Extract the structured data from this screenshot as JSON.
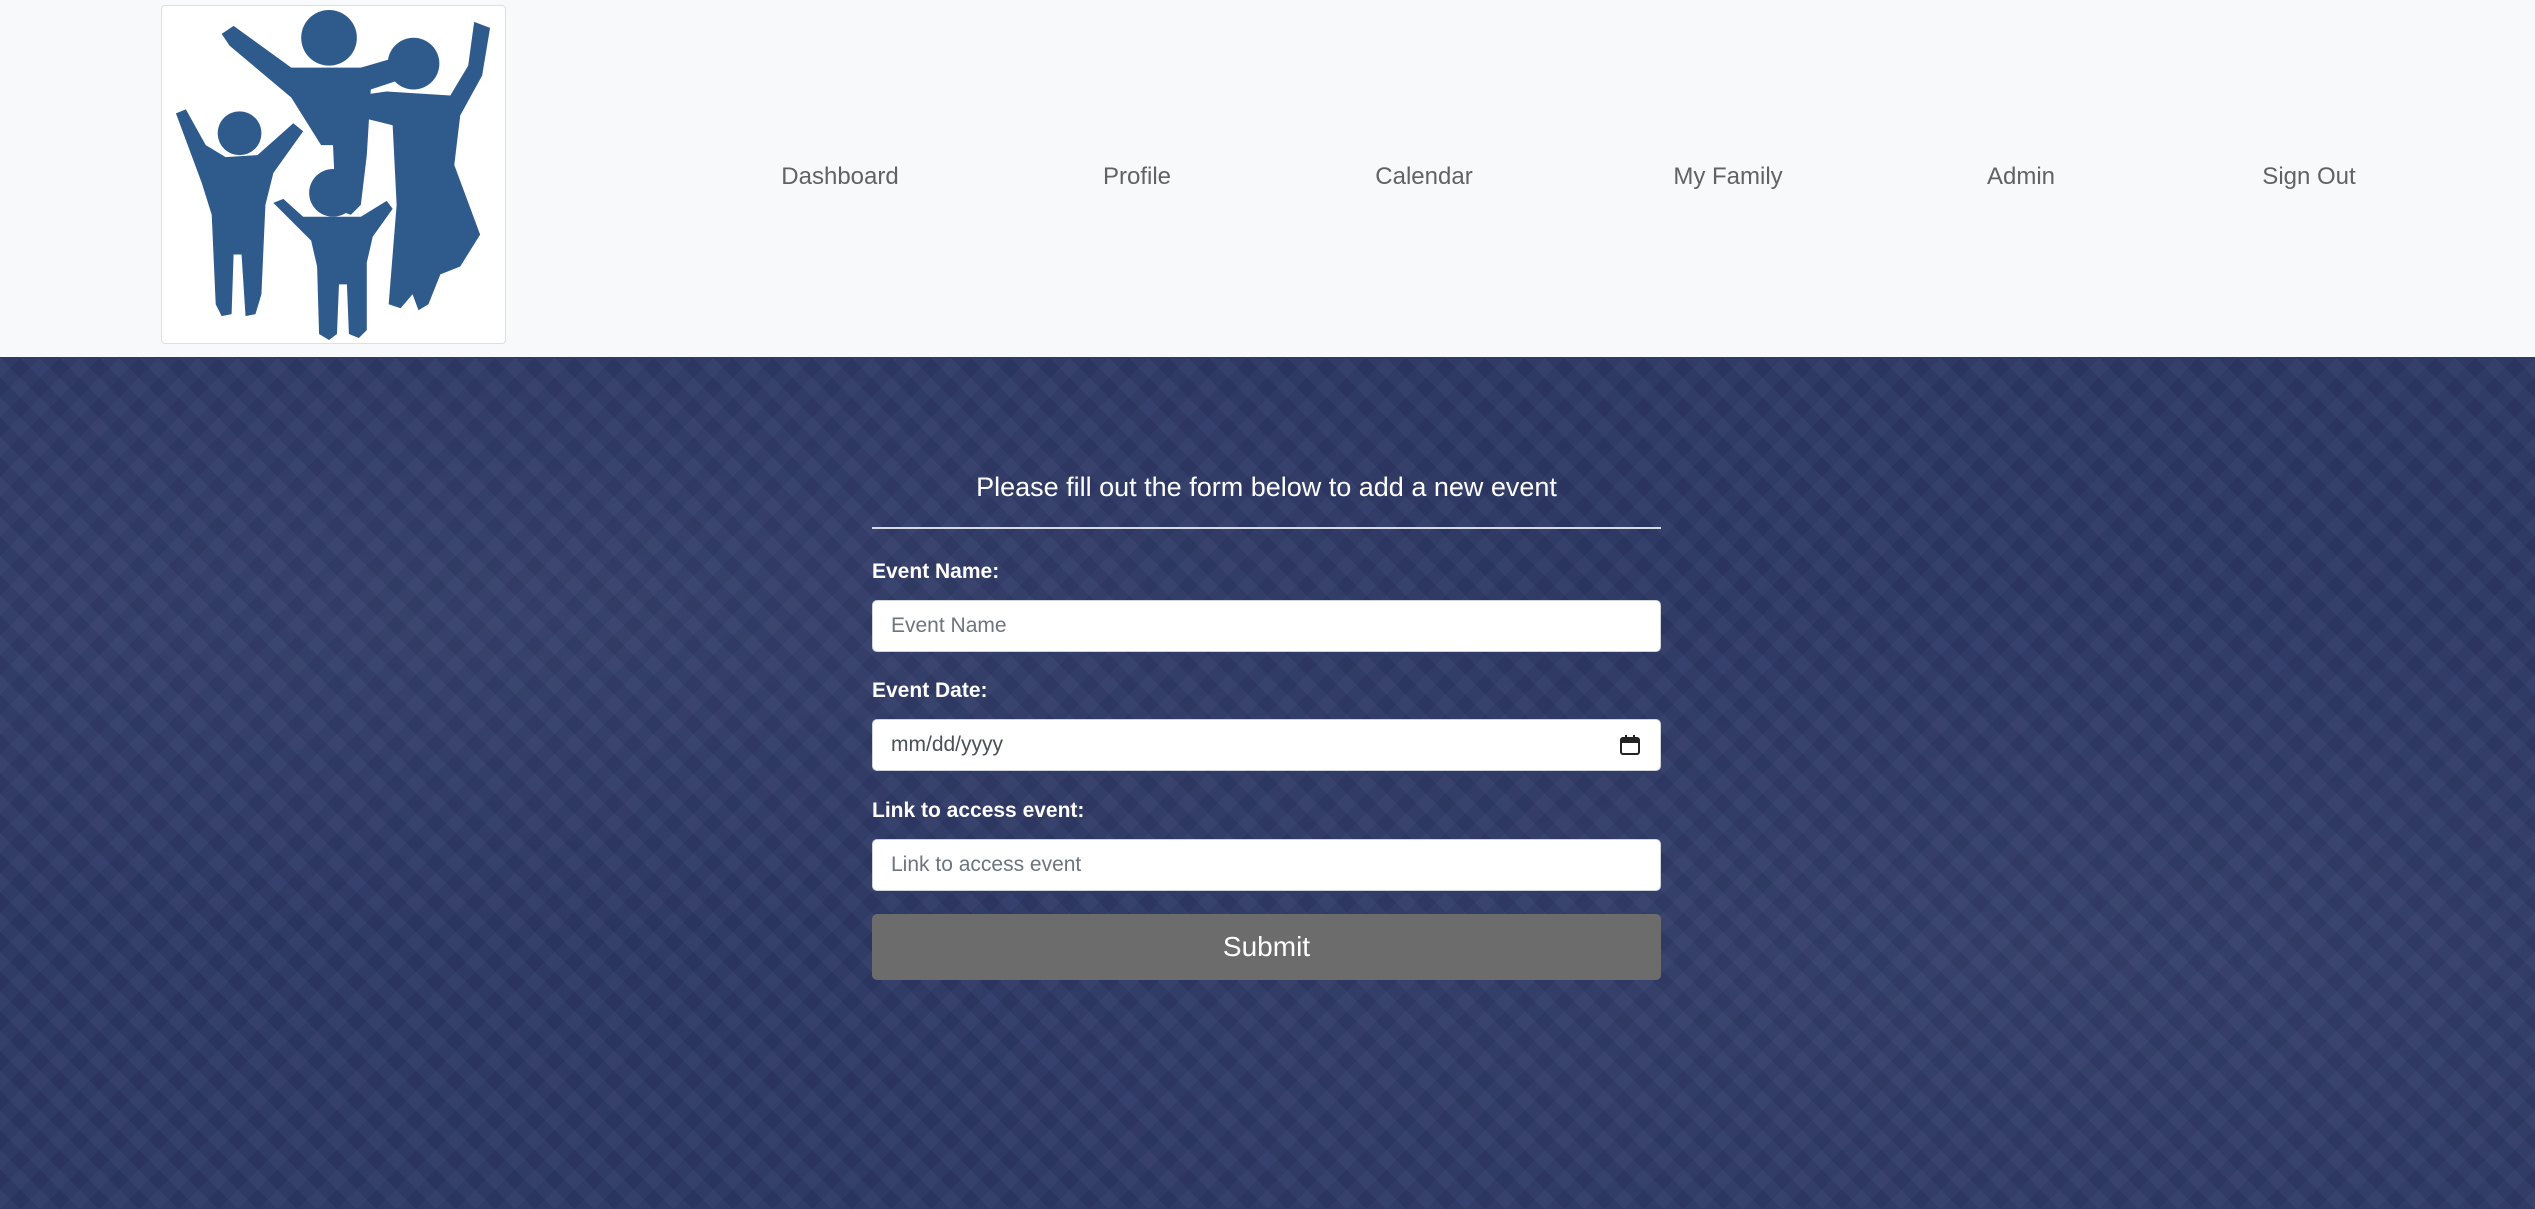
{
  "nav": {
    "links": [
      {
        "label": "Dashboard"
      },
      {
        "label": "Profile"
      },
      {
        "label": "Calendar"
      },
      {
        "label": "My Family"
      },
      {
        "label": "Admin"
      },
      {
        "label": "Sign Out"
      }
    ]
  },
  "logo": {
    "icon": "family-logo-icon",
    "color": "#2f5b8c"
  },
  "form": {
    "title": "Please fill out the form below to add a new event",
    "fields": {
      "event_name": {
        "label": "Event Name:",
        "placeholder": "Event Name",
        "value": ""
      },
      "event_date": {
        "label": "Event Date:",
        "placeholder": "mm/dd/yyyy",
        "value": ""
      },
      "event_link": {
        "label": "Link to access event:",
        "placeholder": "Link to access event",
        "value": ""
      }
    },
    "submit_label": "Submit"
  },
  "colors": {
    "header_bg": "#f8f9fa",
    "main_bg": "#2c3764",
    "submit_bg": "#6c6c6c",
    "text_white": "#ffffff"
  }
}
